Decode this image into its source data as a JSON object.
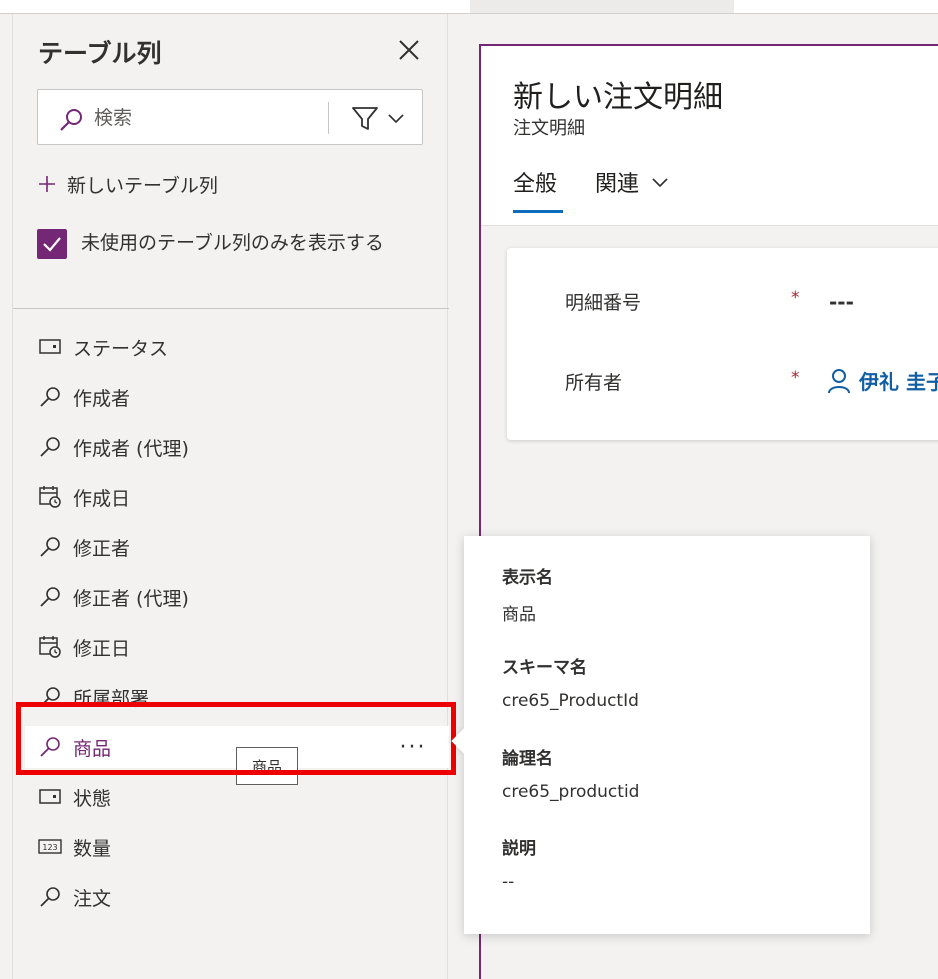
{
  "panel": {
    "title": "テーブル列",
    "search_placeholder": "検索",
    "new_column_label": "新しいテーブル列",
    "show_unused_label": "未使用のテーブル列のみを表示する",
    "show_unused_checked": true,
    "fields": [
      {
        "label": "ステータス",
        "icon": "option-set-icon"
      },
      {
        "label": "作成者",
        "icon": "lookup-icon"
      },
      {
        "label": "作成者 (代理)",
        "icon": "lookup-icon"
      },
      {
        "label": "作成日",
        "icon": "calendar-clock-icon"
      },
      {
        "label": "修正者",
        "icon": "lookup-icon"
      },
      {
        "label": "修正者 (代理)",
        "icon": "lookup-icon"
      },
      {
        "label": "修正日",
        "icon": "calendar-clock-icon"
      },
      {
        "label": "所属部署",
        "icon": "lookup-icon"
      },
      {
        "label": "商品",
        "icon": "lookup-icon",
        "selected": true
      },
      {
        "label": "状態",
        "icon": "option-set-icon"
      },
      {
        "label": "数量",
        "icon": "number-icon"
      },
      {
        "label": "注文",
        "icon": "lookup-icon"
      }
    ],
    "more_label": "···",
    "tooltip": "商品"
  },
  "form": {
    "title": "新しい注文明細",
    "subtitle": "注文明細",
    "tabs": [
      {
        "label": "全般",
        "active": true
      },
      {
        "label": "関連",
        "active": false
      }
    ],
    "fields": {
      "line_number": {
        "label": "明細番号",
        "required": "*",
        "value": "---"
      },
      "owner": {
        "label": "所有者",
        "required": "*",
        "value": "伊礼 圭子"
      }
    }
  },
  "flyout": {
    "display_name_label": "表示名",
    "display_name_value": "商品",
    "schema_name_label": "スキーマ名",
    "schema_name_value": "cre65_ProductId",
    "logical_name_label": "論理名",
    "logical_name_value": "cre65_productid",
    "description_label": "説明",
    "description_value": "--"
  },
  "colors": {
    "accent": "#742774",
    "link": "#115ea3",
    "tab_underline": "#0f6cbd",
    "required": "#a4262c",
    "highlight": "#ef0000"
  }
}
